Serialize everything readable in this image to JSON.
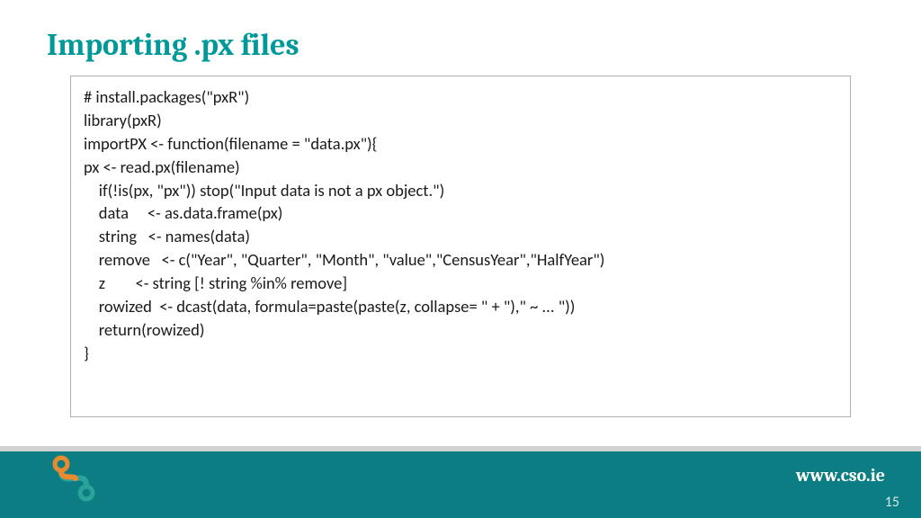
{
  "slide": {
    "title": "Importing .px files"
  },
  "code": {
    "l1": "# install.packages(\"pxR\")",
    "l2": "library(pxR)",
    "l3": "",
    "l4": "importPX <- function(filename = \"data.px\"){",
    "l5": "px <- read.px(filename)",
    "l6": "    if(!is(px, \"px\")) stop(\"Input data is not a px object.\")",
    "l7": "    data     <- as.data.frame(px)",
    "l8": "    string   <- names(data)",
    "l9": "    remove   <- c(\"Year\", \"Quarter\", \"Month\", \"value\",\"CensusYear\",\"HalfYear\")",
    "l10": "    z        <- string [! string %in% remove]",
    "l11": "    rowized  <- dcast(data, formula=paste(paste(z, collapse= \" + \"),\" ~ ... \"))",
    "l12": "    return(rowized)",
    "l13": "}"
  },
  "footer": {
    "url": "www.cso.ie",
    "page": "15"
  },
  "colors": {
    "accent": "#009999",
    "footer_bg": "#0d7d84",
    "logo_orange": "#e88b2e",
    "logo_teal": "#2aa39a"
  }
}
